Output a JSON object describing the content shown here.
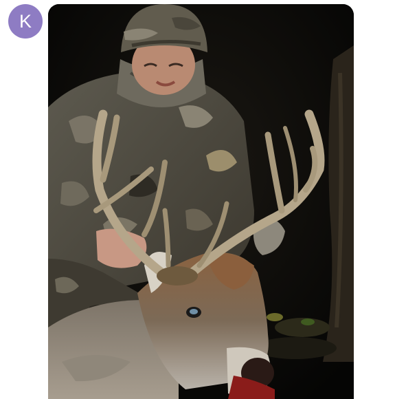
{
  "avatar": {
    "initial": "K",
    "color": "#8e7cc3"
  },
  "message_photo": {
    "alt": ""
  }
}
